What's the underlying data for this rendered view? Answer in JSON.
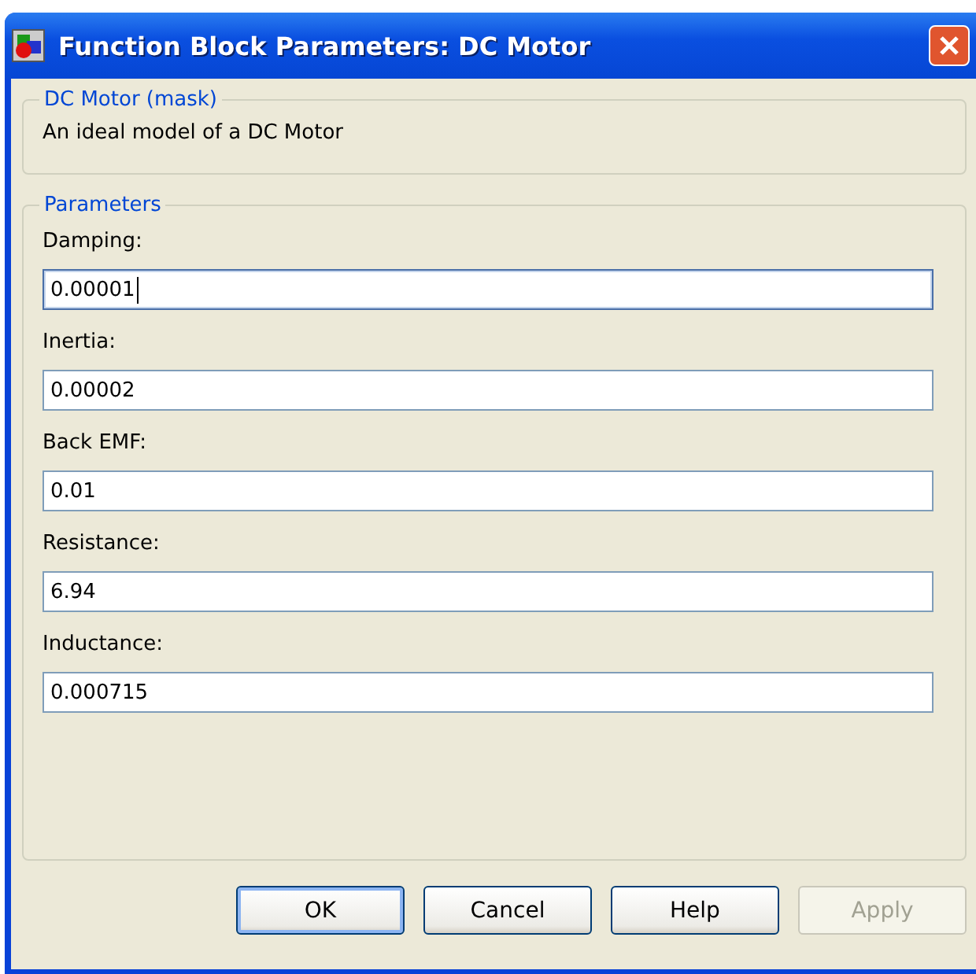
{
  "window": {
    "title": "Function Block Parameters: DC Motor"
  },
  "description_group": {
    "title": "DC Motor (mask)",
    "text": "An ideal model of a DC Motor"
  },
  "parameters_group": {
    "title": "Parameters",
    "fields": [
      {
        "label": "Damping:",
        "value": "0.00001",
        "focused": true
      },
      {
        "label": "Inertia:",
        "value": "0.00002",
        "focused": false
      },
      {
        "label": "Back EMF:",
        "value": "0.01",
        "focused": false
      },
      {
        "label": "Resistance:",
        "value": "6.94",
        "focused": false
      },
      {
        "label": "Inductance:",
        "value": "0.000715",
        "focused": false
      }
    ]
  },
  "buttons": [
    {
      "label": "OK",
      "default": true,
      "disabled": false
    },
    {
      "label": "Cancel",
      "default": false,
      "disabled": false
    },
    {
      "label": "Help",
      "default": false,
      "disabled": false
    },
    {
      "label": "Apply",
      "default": false,
      "disabled": true
    }
  ]
}
